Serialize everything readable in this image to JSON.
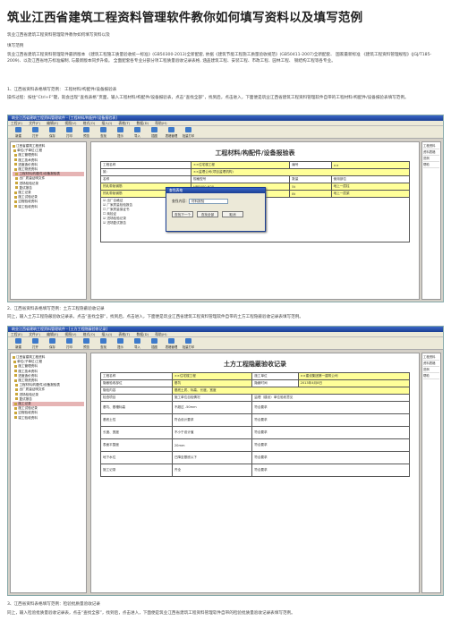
{
  "article": {
    "title": "筑业江西省建筑工程资料管理软件教你如何填写资料以及填写范例",
    "subtitle": "筑业江西省建筑工程资料管理软件教你如何填写资料以及",
    "section": "填写范例",
    "intro": "筑业江西省建筑工程资料管理软件最新版本 《建筑工程施工质量验收统一标准》(GB50300-2013)全新配套, 依据《建筑节能工程施工质量验收规范》(GB50411-2007)全新配套、 国家最新标准 《建筑工程资料管理规程》(JGJ/T185-2009)、以及江西省地方标准编制, 与最新版本同步升级。 全面配套各专业分部分项工程质量验收记录表格, 涵盖建筑工程、安装工程、市政工程、园林工程、 钢结构工程等各专业。",
    "step1_head": "1、江西省资料表格填写范例： 工程材料/构配件/设备报验表",
    "step1_body": "操作过程：按住“Ctrl+F”键，就会出现“查找表格”页面，输入工程材料/构配件/设备报验表，点击“查找全部”，找到后，点击进入，下面便是筑业江西省建筑工程资料管理软件自带的工程材料/构配件/设备报验表填写范例。",
    "step2_head": "2、江西省资料表格填写范例：土方工程隐蔽验收记录",
    "step2_body": "同上，输入土方工程隐蔽验收记录表，点击“查找全部”，找到后，点击进入，下面便是筑业江西省建筑工程资料管理软件自带的土方工程隐蔽验收记录表填写范例。",
    "step3_head": "3、江西省资料表格填写范例：检验批质量验收记录",
    "step3_body": "同上，输入检验批质量验收记录表，点击“查找全部”，找到后，点击进入，下面便是筑业江西省建筑工程资料管理软件自带的检验批质量验收记录表填写范例。"
  },
  "app": {
    "window_title": "筑业江西省建筑工程资料管理软件 - [工程材料/构配件/设备报验表]",
    "window_title2": "筑业江西省建筑工程资料管理软件 - [土方工程隐蔽验收记录]",
    "menu": [
      "工程(E)",
      "文件(F)",
      "编辑(E)",
      "视图(V)",
      "格式(O)",
      "插入(I)",
      "表格(T)",
      "数据(D)",
      "帮助(H)"
    ],
    "tools": [
      "新建",
      "打开",
      "保存",
      "打印",
      "预览",
      "查找",
      "提示",
      "导入",
      "插图",
      "表格管理",
      "批量打印"
    ],
    "side_items": [
      "工程资料",
      "资料表格",
      "范例",
      "帮助"
    ]
  },
  "form1": {
    "title": "工程材料/构配件/设备报验表",
    "rows": [
      [
        "工程名称",
        "××住宅楼工程",
        "编号",
        "××"
      ],
      [
        "致：",
        "××监理公司(项目监理机构)",
        "",
        ""
      ],
      [
        "名称",
        "规格型号",
        "数量",
        "使用部位"
      ],
      [
        "热轧带肋钢筋",
        "HRB400 Φ20",
        "5t",
        "地上一层柱"
      ],
      [
        "热轧带肋钢筋",
        "HRB400 Φ22",
        "8t",
        "地上一层梁"
      ]
    ],
    "checks": [
      "出厂合格证",
      "厂家质量检验报告",
      "厂家质量保证书",
      "商检证",
      "进场检验记录",
      "进场复试报告"
    ]
  },
  "dialog": {
    "title": "查找表格",
    "label": "查找内容：",
    "value": "材料报验",
    "buttons": [
      "查找下一个",
      "查找全部",
      "取消"
    ]
  },
  "form2": {
    "title": "土方工程隐蔽验收记录",
    "rows": [
      [
        "工程名称",
        "××住宅楼工程",
        "施工单位",
        "××建设集团第一建筑公司"
      ],
      [
        "隐蔽验收部位",
        "基坑",
        "隐蔽时间",
        "2013年4月8日"
      ],
      [
        "隐检内容",
        "基底土质、标高、长度、宽度",
        "",
        ""
      ],
      [
        "检查项目",
        "施工单位自检情况",
        "监理（建设）单位验收意见",
        ""
      ],
      [
        "基坑、基槽标高",
        "不超过 -50mm",
        "符合要求",
        ""
      ],
      [
        "基底土性",
        "符合设计要求",
        "符合要求",
        ""
      ],
      [
        "长度、宽度",
        "不小于设计值",
        "符合要求",
        ""
      ],
      [
        "表面平整度",
        "20mm",
        "符合要求",
        ""
      ],
      [
        "地下水位",
        "已降至基底以下",
        "符合要求",
        ""
      ],
      [
        "施工记录",
        "齐全",
        "符合要求",
        ""
      ]
    ]
  },
  "tree": [
    "江西省建筑工程资料",
    "单位(子单位)工程",
    "施工管理资料",
    "施工技术资料",
    "进度造价资料",
    "施工物资资料",
    "工程材料/构配件/设备报验表",
    "出厂质量证明文件",
    "进场检验记录",
    "复试报告",
    "施工记录",
    "施工试验记录",
    "过程验收资料",
    "竣工验收资料"
  ]
}
